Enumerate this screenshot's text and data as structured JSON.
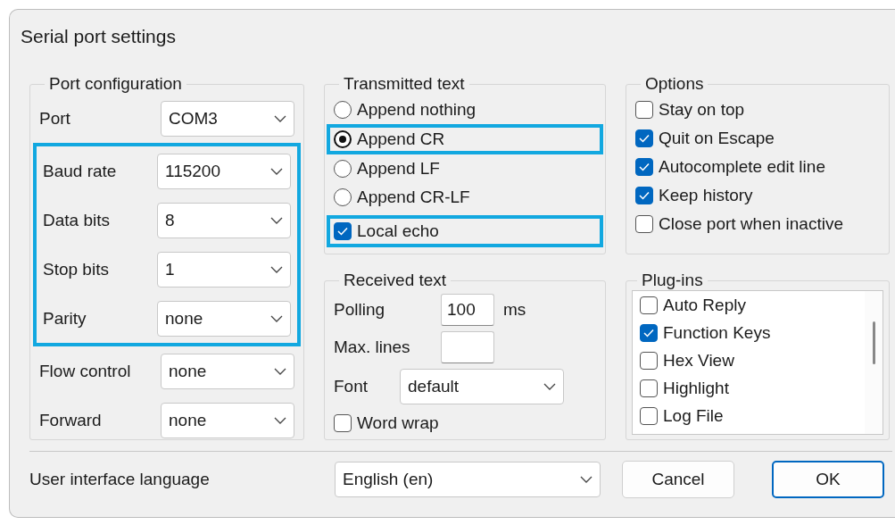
{
  "window": {
    "title": "Serial port settings"
  },
  "port_configuration": {
    "title": "Port configuration",
    "fields": [
      {
        "label": "Port",
        "value": "COM3",
        "highlighted": false
      },
      {
        "label": "Baud rate",
        "value": "115200",
        "highlighted": true
      },
      {
        "label": "Data bits",
        "value": "8",
        "highlighted": true
      },
      {
        "label": "Stop bits",
        "value": "1",
        "highlighted": true
      },
      {
        "label": "Parity",
        "value": "none",
        "highlighted": true
      },
      {
        "label": "Flow control",
        "value": "none",
        "highlighted": false
      },
      {
        "label": "Forward",
        "value": "none",
        "highlighted": false
      }
    ]
  },
  "transmitted_text": {
    "title": "Transmitted text",
    "options": [
      {
        "label": "Append nothing",
        "selected": false,
        "highlighted": false
      },
      {
        "label": "Append CR",
        "selected": true,
        "highlighted": true
      },
      {
        "label": "Append LF",
        "selected": false,
        "highlighted": false
      },
      {
        "label": "Append CR-LF",
        "selected": false,
        "highlighted": false
      }
    ],
    "local_echo": {
      "label": "Local echo",
      "checked": true,
      "highlighted": true
    }
  },
  "received_text": {
    "title": "Received text",
    "polling": {
      "label": "Polling",
      "value": "100",
      "unit": "ms"
    },
    "max_lines": {
      "label": "Max. lines"
    },
    "font": {
      "label": "Font",
      "value": "default"
    },
    "word_wrap": {
      "label": "Word wrap",
      "checked": false
    }
  },
  "options": {
    "title": "Options",
    "items": [
      {
        "label": "Stay on top",
        "checked": false
      },
      {
        "label": "Quit on Escape",
        "checked": true
      },
      {
        "label": "Autocomplete edit line",
        "checked": true
      },
      {
        "label": "Keep history",
        "checked": true
      },
      {
        "label": "Close port when inactive",
        "checked": false
      }
    ]
  },
  "plugins": {
    "title": "Plug-ins",
    "items": [
      {
        "label": "Auto Reply",
        "checked": false
      },
      {
        "label": "Function Keys",
        "checked": true
      },
      {
        "label": "Hex View",
        "checked": false
      },
      {
        "label": "Highlight",
        "checked": false
      },
      {
        "label": "Log File",
        "checked": false
      }
    ]
  },
  "language": {
    "label": "User interface language",
    "value": "English (en)"
  },
  "buttons": [
    {
      "label": "Cancel",
      "default": false
    },
    {
      "label": "OK",
      "default": true
    }
  ]
}
